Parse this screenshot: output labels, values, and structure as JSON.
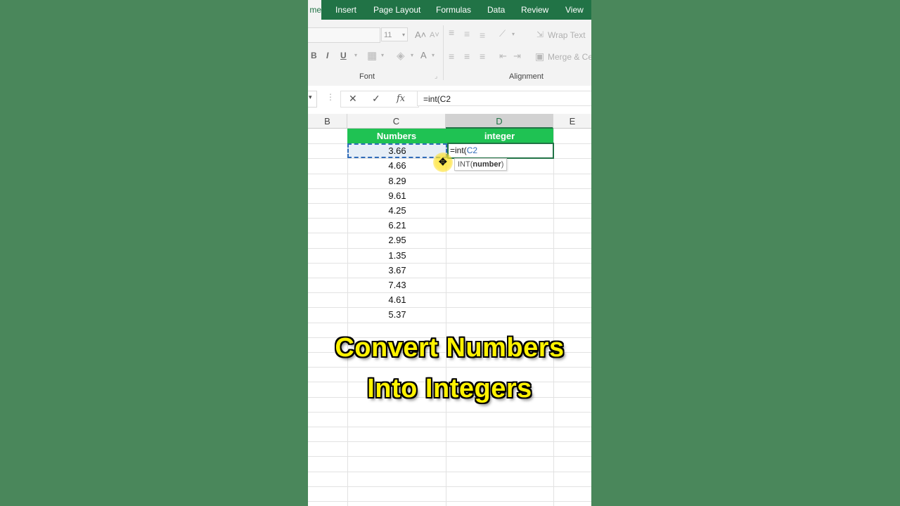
{
  "ribbon": {
    "tabs": [
      {
        "label": "me",
        "active": true
      },
      {
        "label": "Insert"
      },
      {
        "label": "Page Layout"
      },
      {
        "label": "Formulas"
      },
      {
        "label": "Data"
      },
      {
        "label": "Review"
      },
      {
        "label": "View"
      }
    ],
    "font_size": "11",
    "wrap_text": "Wrap Text",
    "merge": "Merge & Ce",
    "font_group": "Font",
    "alignment_group": "Alignment",
    "bold": "B",
    "italic": "I",
    "underline": "U",
    "grow": "A",
    "color": "A"
  },
  "formula_bar": {
    "cancel": "✕",
    "enter": "✓",
    "fx": "fx",
    "value": "=int(C2"
  },
  "columns": [
    "B",
    "C",
    "D",
    "E"
  ],
  "selected_column": "D",
  "table": {
    "headers": {
      "numbers": "Numbers",
      "integer": "integer"
    },
    "numbers": [
      "3.66",
      "4.66",
      "8.29",
      "9.61",
      "4.25",
      "6.21",
      "2.95",
      "1.35",
      "3.67",
      "7.43",
      "4.61",
      "5.37"
    ],
    "editing_prefix": "=int(",
    "editing_ref": "C2",
    "tooltip_fn": "INT(",
    "tooltip_arg": "number",
    "tooltip_close": ")"
  },
  "caption": {
    "line1": "Convert Numbers",
    "line2": "Into Integers"
  },
  "colors": {
    "header_green": "#1fc253",
    "ribbon_green": "#217346",
    "caption_yellow": "#fff200",
    "background": "#4a875b"
  }
}
